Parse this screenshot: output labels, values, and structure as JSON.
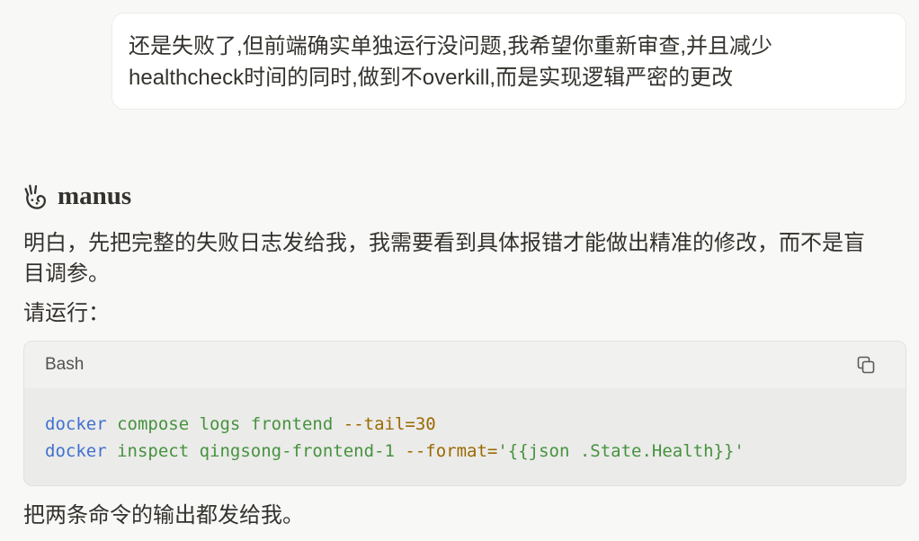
{
  "colors": {
    "page_background": "#f8f8f7",
    "text": "#34322d",
    "user_bubble_background": "#ffffff",
    "code_header_background": "#f1f1f0",
    "code_body_background": "#ebebe9"
  },
  "user_message": {
    "text": "还是失败了,但前端确实单独运行没问题,我希望你重新审查,并且减少healthcheck时间的同时,做到不overkill,而是实现逻辑严密的更改"
  },
  "assistant": {
    "logo_icon": "manus-logo-icon",
    "name": "manus",
    "intro": "明白，先把完整的失败日志发给我，我需要看到具体报错才能做出精准的修改，而不是盲目调参。",
    "run_prompt": "请运行：",
    "code_block": {
      "language": "Bash",
      "copy_icon": "copy-icon",
      "lines": [
        {
          "tokens": [
            {
              "text": "docker",
              "color": "#4070d0"
            },
            {
              "text": " compose logs frontend ",
              "color": "#46923f"
            },
            {
              "text": "--tail=30",
              "color": "#9a6a00"
            }
          ]
        },
        {
          "tokens": [
            {
              "text": "docker",
              "color": "#4070d0"
            },
            {
              "text": " inspect qingsong-frontend-1 ",
              "color": "#46923f"
            },
            {
              "text": "--format=",
              "color": "#9a6a00"
            },
            {
              "text": "'{{json .State.Health}}'",
              "color": "#46923f"
            }
          ]
        }
      ]
    },
    "closing": "把两条命令的输出都发给我。"
  }
}
